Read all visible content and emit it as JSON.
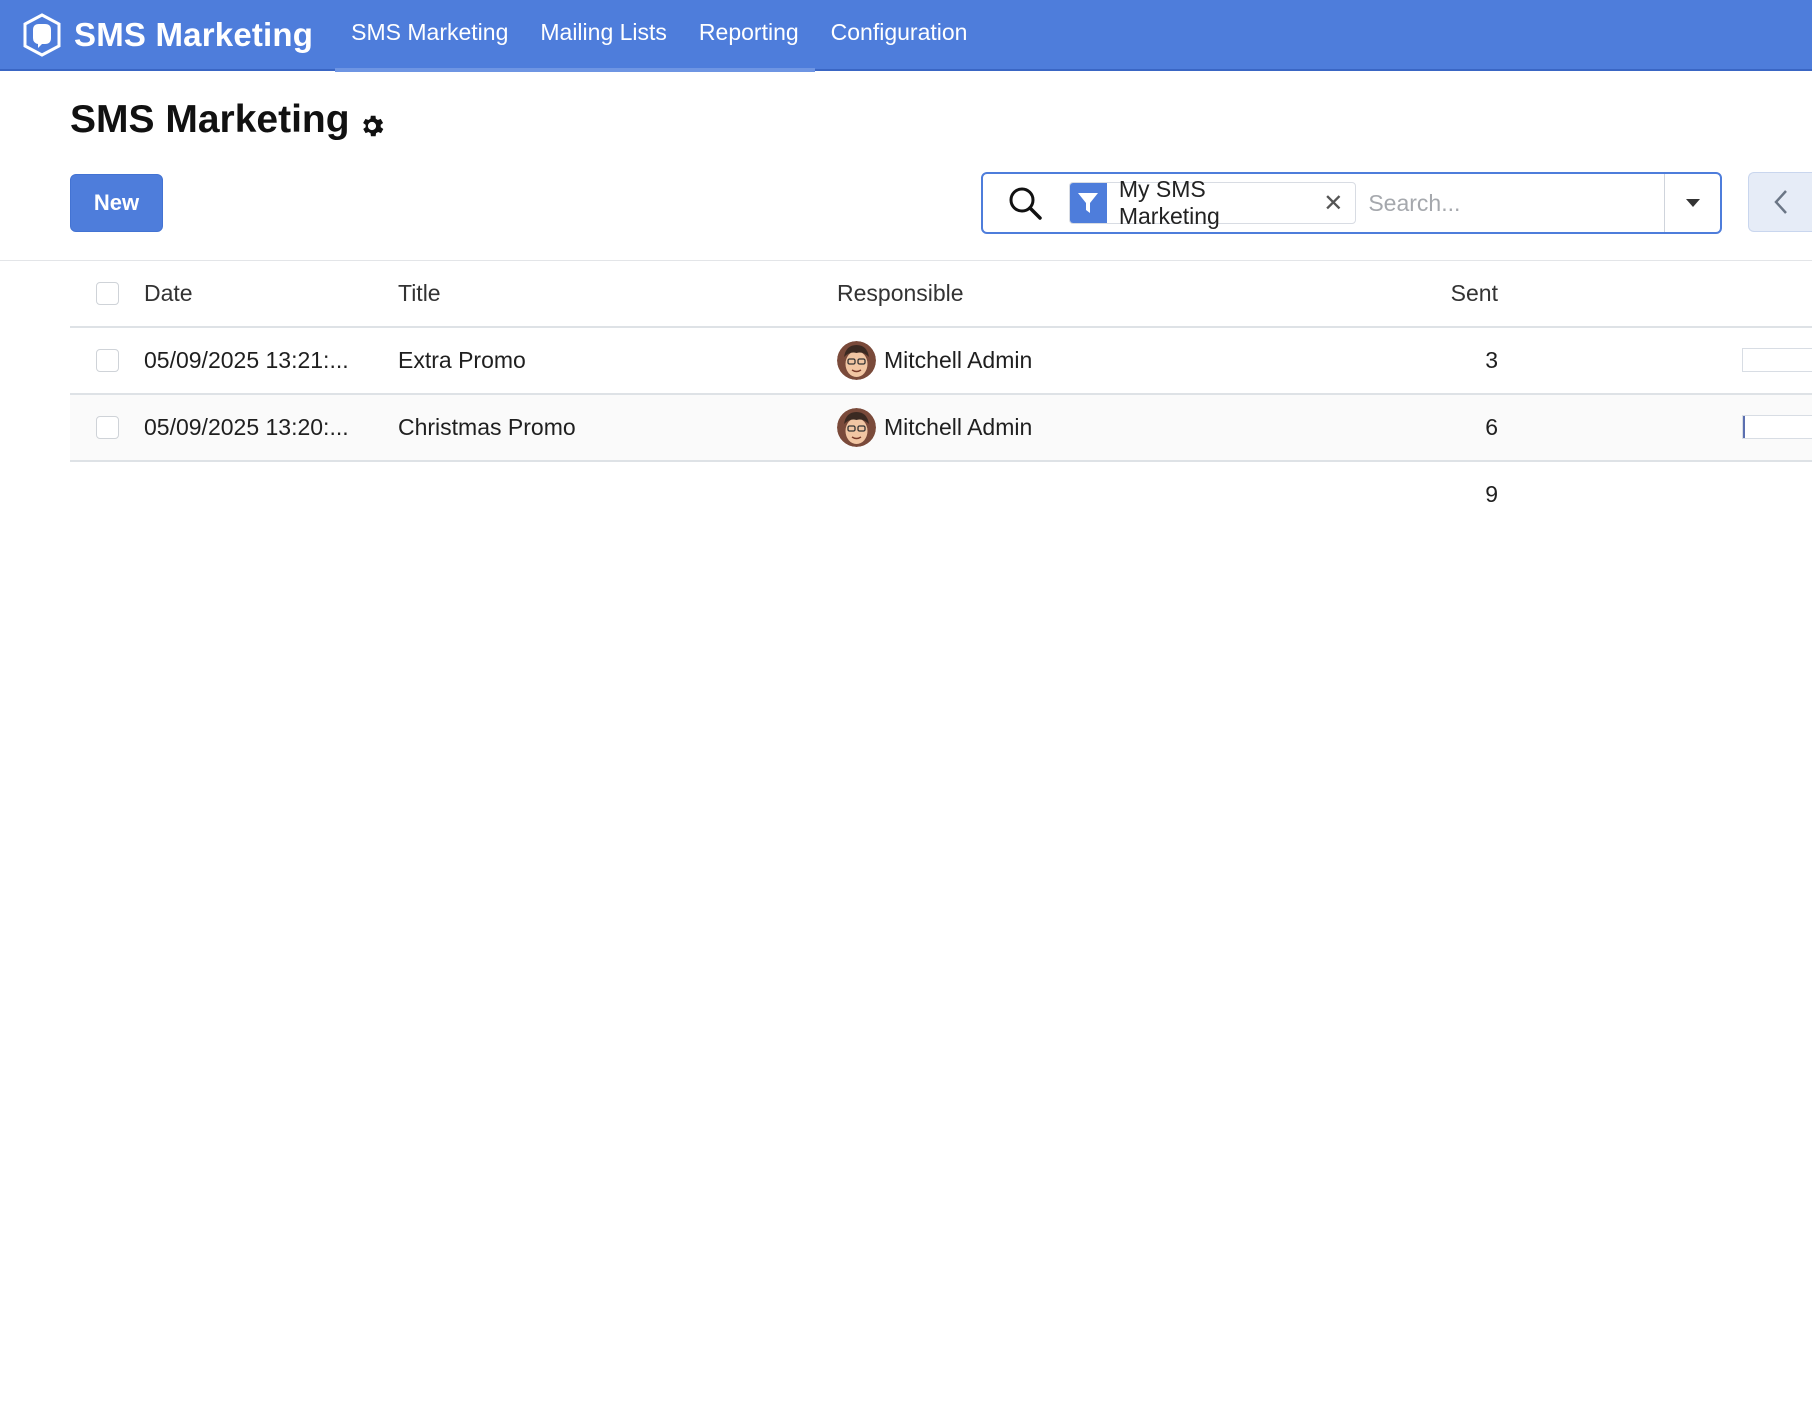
{
  "app": {
    "brand_name": "SMS Marketing",
    "menu": [
      {
        "label": "SMS Marketing"
      },
      {
        "label": "Mailing Lists"
      },
      {
        "label": "Reporting"
      },
      {
        "label": "Configuration"
      }
    ]
  },
  "control_panel": {
    "title": "SMS Marketing",
    "new_button": "New",
    "search": {
      "facet_label": "My SMS Marketing",
      "placeholder": "Search..."
    }
  },
  "table": {
    "columns": {
      "date": "Date",
      "title": "Title",
      "responsible": "Responsible",
      "sent": "Sent"
    },
    "rows": [
      {
        "date": "05/09/2025 13:21:...",
        "title": "Extra Promo",
        "responsible": "Mitchell Admin",
        "sent": "3",
        "progress": 0.0
      },
      {
        "date": "05/09/2025 13:20:...",
        "title": "Christmas Promo",
        "responsible": "Mitchell Admin",
        "sent": "6",
        "progress": 0.03
      }
    ],
    "total_sent": "9"
  },
  "colors": {
    "primary": "#4e7ddb",
    "progress_fill": "#5b6fb0"
  },
  "icons": [
    "brand-logo-icon",
    "gear-icon",
    "search-icon",
    "filter-icon",
    "close-icon",
    "caret-down-icon",
    "chevron-left-icon",
    "avatar"
  ]
}
